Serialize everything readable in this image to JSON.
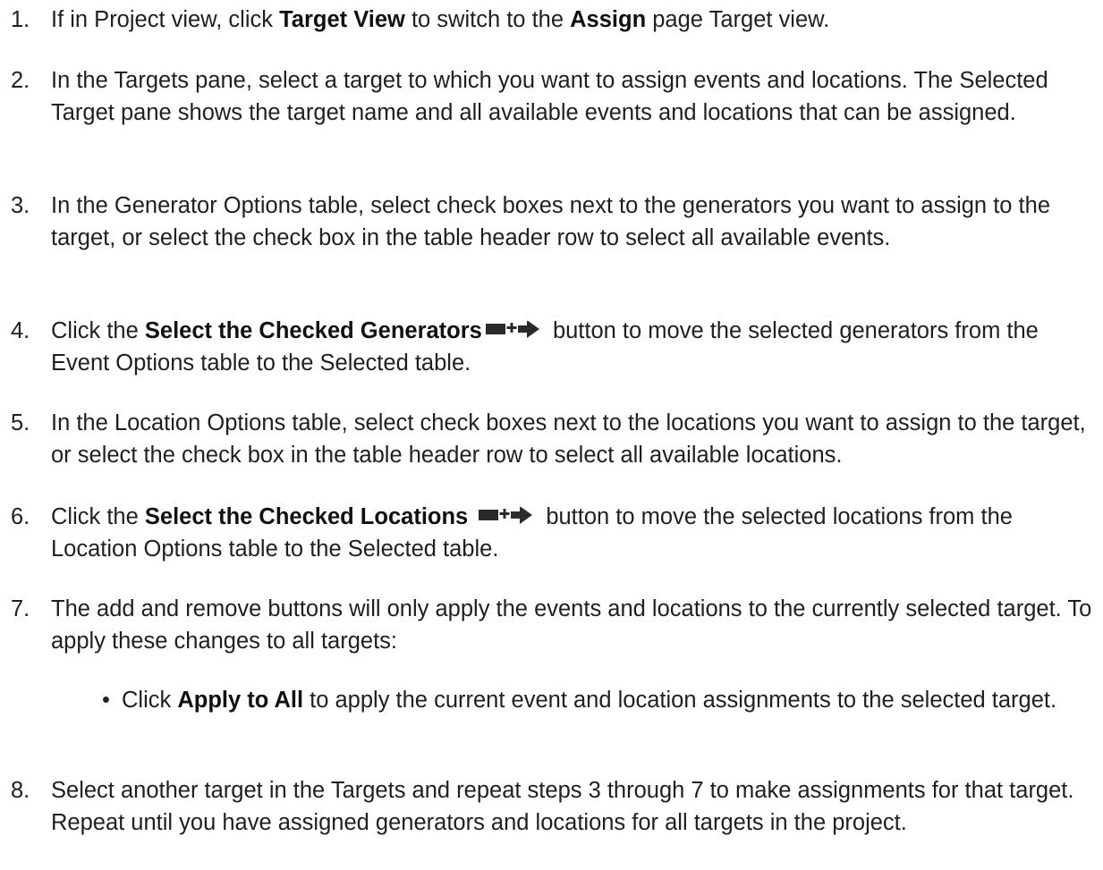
{
  "steps": [
    {
      "num": "1.",
      "parts": [
        "If in Project view, click ",
        "Target View",
        " to switch to the ",
        "Assign",
        " page Target view."
      ]
    },
    {
      "num": "2.",
      "text": "In the Targets pane, select a target to which you want to assign events and locations. The Selected Target pane shows the target name and all available events and locations that can be assigned."
    },
    {
      "num": "3.",
      "text": "In the Generator Options table, select check boxes next to the generators you want to assign to the target, or select the check box in the table header row to select all available events."
    },
    {
      "num": "4.",
      "parts": [
        "Click the ",
        "Select the Checked Generators",
        " button to move the selected generators from the Event Options table to the Selected table."
      ],
      "icon": "select-checked-add-arrow-icon"
    },
    {
      "num": "5.",
      "text": "In the Location Options table, select check boxes next to the locations you want to assign to the target, or select the check box in the table header row to select all available locations."
    },
    {
      "num": "6.",
      "parts": [
        "Click the ",
        "Select the Checked Locations",
        " button to move the selected locations from the Location Options table to the Selected table."
      ],
      "icon": "select-checked-add-arrow-icon"
    },
    {
      "num": "7.",
      "text": "The add and remove buttons will only apply the events and locations to the currently selected target. To apply these changes to all targets:",
      "subitems": [
        {
          "bullet": "•",
          "parts": [
            "Click ",
            "Apply to All",
            " to apply the current event and location assignments to the selected target."
          ]
        }
      ]
    },
    {
      "num": "8.",
      "text": "Select another target in the Targets and repeat steps 3 through 7 to make assignments for that target. Repeat until you have assigned generators and locations for all targets in the project."
    }
  ],
  "colors": {
    "text": "#1f1f1f",
    "icon": "#2b2b2b"
  }
}
